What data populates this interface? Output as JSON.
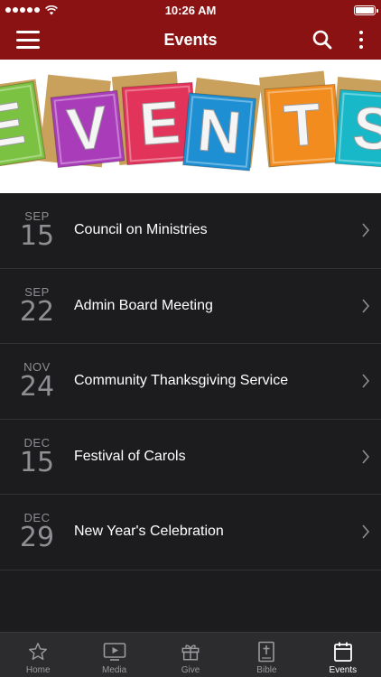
{
  "status_bar": {
    "time": "10:26 AM"
  },
  "nav": {
    "title": "Events"
  },
  "banner": {
    "letters": [
      "E",
      "V",
      "E",
      "N",
      "T",
      "S"
    ],
    "tile_colors": [
      "#7cc242",
      "#a93db9",
      "#e2345a",
      "#1e8fd3",
      "#f28c1e",
      "#18b8c9"
    ]
  },
  "events": [
    {
      "month": "SEP",
      "day": "15",
      "title": "Council on Ministries"
    },
    {
      "month": "SEP",
      "day": "22",
      "title": "Admin Board Meeting"
    },
    {
      "month": "NOV",
      "day": "24",
      "title": "Community Thanksgiving Service"
    },
    {
      "month": "DEC",
      "day": "15",
      "title": "Festival of Carols"
    },
    {
      "month": "DEC",
      "day": "29",
      "title": "New Year's Celebration"
    }
  ],
  "tabs": [
    {
      "label": "Home",
      "icon": "star-icon",
      "active": false
    },
    {
      "label": "Media",
      "icon": "play-screen-icon",
      "active": false
    },
    {
      "label": "Give",
      "icon": "gift-icon",
      "active": false
    },
    {
      "label": "Bible",
      "icon": "bible-icon",
      "active": false
    },
    {
      "label": "Events",
      "icon": "calendar-icon",
      "active": true
    }
  ],
  "colors": {
    "header": "#8b1212",
    "list_background": "#1c1c1e",
    "tab_bar": "#2c2c2e"
  }
}
